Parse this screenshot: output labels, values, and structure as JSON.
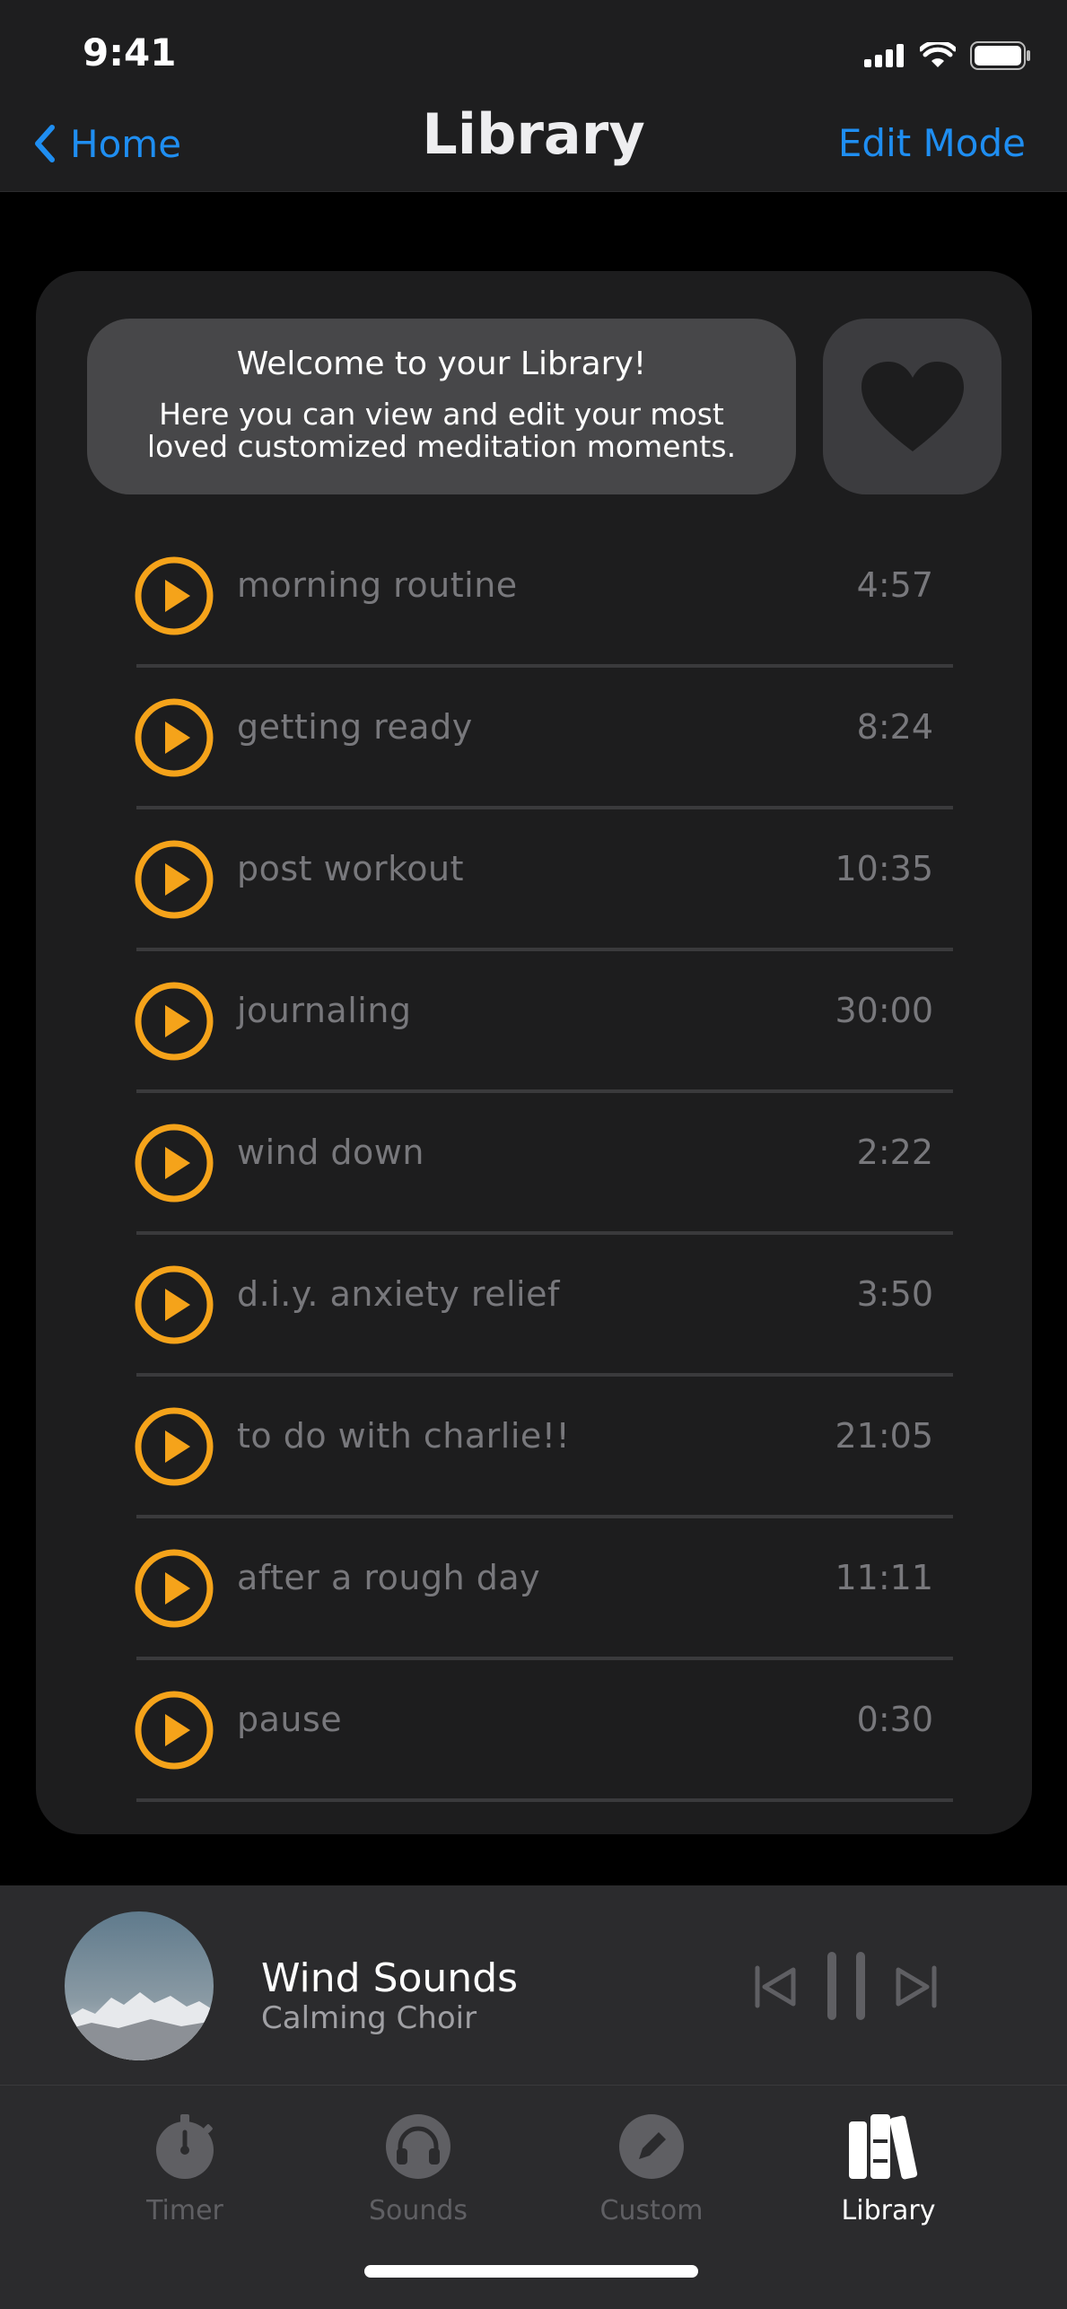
{
  "status": {
    "time": "9:41"
  },
  "nav": {
    "back_label": "Home",
    "title": "Library",
    "edit_label": "Edit Mode"
  },
  "welcome": {
    "title": "Welcome to your Library!",
    "body": "Here you can view and edit your most loved customized meditation moments."
  },
  "colors": {
    "accent": "#f5a31a",
    "link": "#1f8ef1",
    "muted_text": "#78787c"
  },
  "moments": [
    {
      "title": "morning routine",
      "duration": "4:57"
    },
    {
      "title": "getting ready",
      "duration": "8:24"
    },
    {
      "title": "post workout",
      "duration": "10:35"
    },
    {
      "title": "journaling",
      "duration": "30:00"
    },
    {
      "title": "wind down",
      "duration": "2:22"
    },
    {
      "title": "d.i.y. anxiety relief",
      "duration": "3:50"
    },
    {
      "title": "to do with charlie!!",
      "duration": "21:05"
    },
    {
      "title": "after a rough day",
      "duration": "11:11"
    },
    {
      "title": "pause",
      "duration": "0:30"
    }
  ],
  "player": {
    "title": "Wind Sounds",
    "artist": "Calming Choir"
  },
  "tabs": [
    {
      "label": "Timer",
      "icon": "stopwatch-icon",
      "active": false
    },
    {
      "label": "Sounds",
      "icon": "headphones-icon",
      "active": false
    },
    {
      "label": "Custom",
      "icon": "pencil-icon",
      "active": false
    },
    {
      "label": "Library",
      "icon": "books-icon",
      "active": true
    }
  ]
}
